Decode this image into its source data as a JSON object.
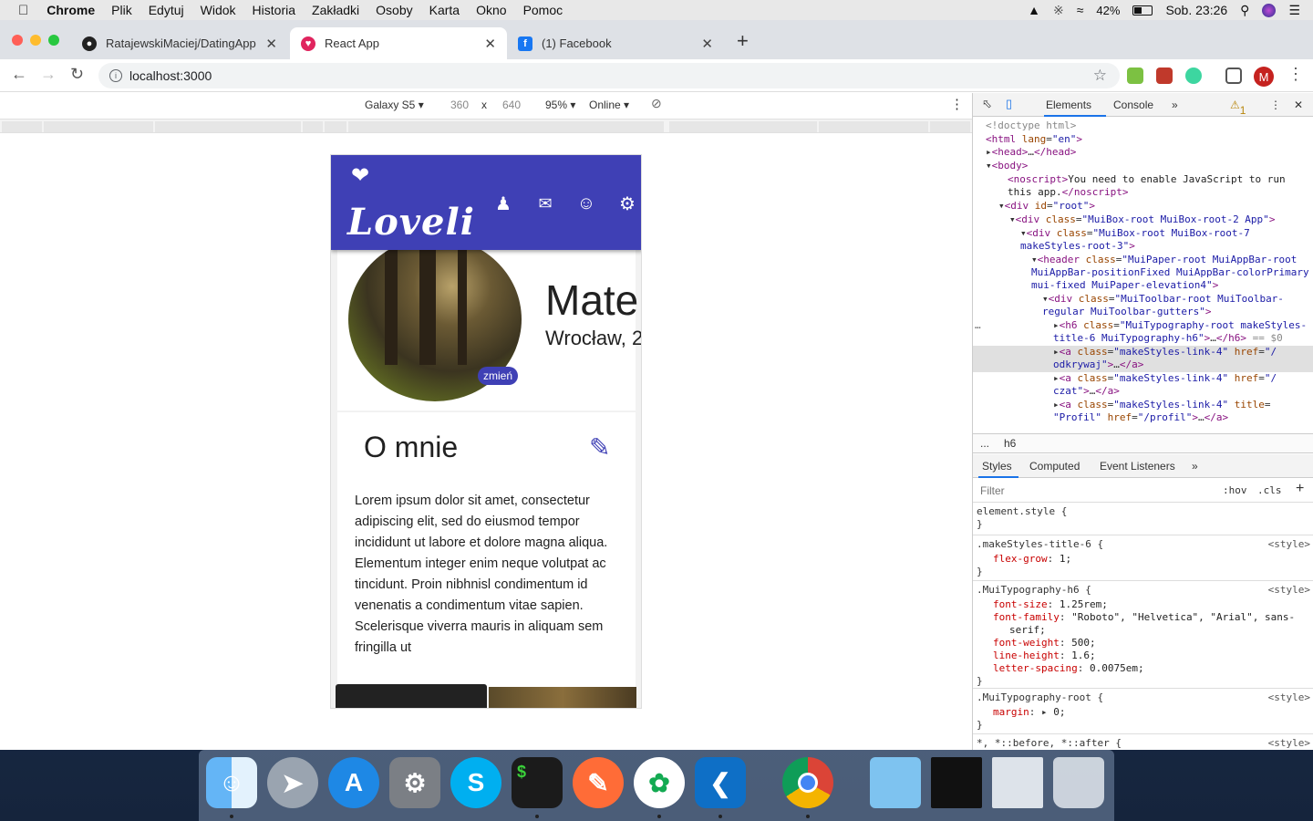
{
  "menubar": {
    "app": "Chrome",
    "items": [
      "Plik",
      "Edytuj",
      "Widok",
      "Historia",
      "Zakładki",
      "Osoby",
      "Karta",
      "Okno",
      "Pomoc"
    ],
    "battery": "42%",
    "clock": "Sob. 23:26"
  },
  "tabs": [
    {
      "title": "RatajewskiMaciej/DatingApp",
      "icon": "github-icon"
    },
    {
      "title": "React App",
      "icon": "react-app-icon"
    },
    {
      "title": "(1) Facebook",
      "icon": "facebook-icon"
    }
  ],
  "address": {
    "url": "localhost:3000"
  },
  "profile_initial": "M",
  "device_toolbar": {
    "device": "Galaxy S5 ▾",
    "width": "360",
    "x": "x",
    "height": "640",
    "zoom": "95% ▾",
    "network": "Online ▾"
  },
  "app": {
    "logo": "Loveli",
    "zmien": "zmień",
    "name": "Mateu",
    "city": "Wrocław, 2",
    "about_title": "O mnie",
    "about_text": "Lorem ipsum dolor sit amet, consectetur adipiscing elit, sed do eiusmod tempor incididunt ut labore et dolore magna aliqua. Elementum integer enim neque volutpat ac tincidunt. Proin nibhnisl condimentum id venenatis a condimentum vitae sapien. Scelerisque viverra mauris in aliquam sem fringilla ut"
  },
  "devtools": {
    "tabs": [
      "Elements",
      "Console",
      "»"
    ],
    "warnings": "1",
    "breadcrumb": "h6",
    "dots": "...",
    "style_tabs": [
      "Styles",
      "Computed",
      "Event Listeners",
      "»"
    ],
    "filter_placeholder": "Filter",
    "hov": ":hov",
    "cls": ".cls",
    "source": "<style>"
  },
  "dock": [
    "Finder",
    "Launchpad",
    "App Store",
    "System Preferences",
    "Skype",
    "Terminal",
    "Postman",
    "MongoDB Compass",
    "Visual Studio Code",
    "Google Chrome",
    "Downloads",
    "Screenshot",
    "Screenshot",
    "Trash"
  ]
}
